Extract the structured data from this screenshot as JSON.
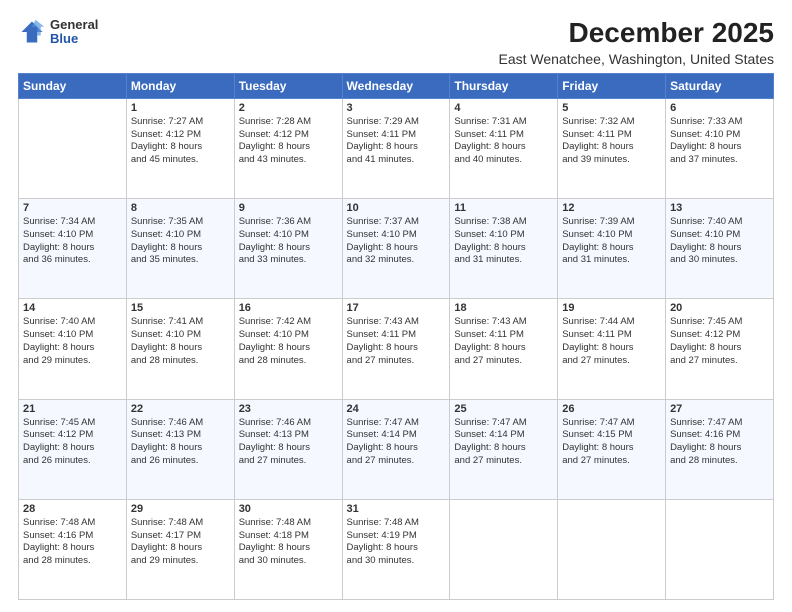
{
  "header": {
    "logo_general": "General",
    "logo_blue": "Blue",
    "title": "December 2025",
    "subtitle": "East Wenatchee, Washington, United States"
  },
  "weekdays": [
    "Sunday",
    "Monday",
    "Tuesday",
    "Wednesday",
    "Thursday",
    "Friday",
    "Saturday"
  ],
  "weeks": [
    [
      {
        "day": "",
        "info": ""
      },
      {
        "day": "1",
        "info": "Sunrise: 7:27 AM\nSunset: 4:12 PM\nDaylight: 8 hours\nand 45 minutes."
      },
      {
        "day": "2",
        "info": "Sunrise: 7:28 AM\nSunset: 4:12 PM\nDaylight: 8 hours\nand 43 minutes."
      },
      {
        "day": "3",
        "info": "Sunrise: 7:29 AM\nSunset: 4:11 PM\nDaylight: 8 hours\nand 41 minutes."
      },
      {
        "day": "4",
        "info": "Sunrise: 7:31 AM\nSunset: 4:11 PM\nDaylight: 8 hours\nand 40 minutes."
      },
      {
        "day": "5",
        "info": "Sunrise: 7:32 AM\nSunset: 4:11 PM\nDaylight: 8 hours\nand 39 minutes."
      },
      {
        "day": "6",
        "info": "Sunrise: 7:33 AM\nSunset: 4:10 PM\nDaylight: 8 hours\nand 37 minutes."
      }
    ],
    [
      {
        "day": "7",
        "info": "Sunrise: 7:34 AM\nSunset: 4:10 PM\nDaylight: 8 hours\nand 36 minutes."
      },
      {
        "day": "8",
        "info": "Sunrise: 7:35 AM\nSunset: 4:10 PM\nDaylight: 8 hours\nand 35 minutes."
      },
      {
        "day": "9",
        "info": "Sunrise: 7:36 AM\nSunset: 4:10 PM\nDaylight: 8 hours\nand 33 minutes."
      },
      {
        "day": "10",
        "info": "Sunrise: 7:37 AM\nSunset: 4:10 PM\nDaylight: 8 hours\nand 32 minutes."
      },
      {
        "day": "11",
        "info": "Sunrise: 7:38 AM\nSunset: 4:10 PM\nDaylight: 8 hours\nand 31 minutes."
      },
      {
        "day": "12",
        "info": "Sunrise: 7:39 AM\nSunset: 4:10 PM\nDaylight: 8 hours\nand 31 minutes."
      },
      {
        "day": "13",
        "info": "Sunrise: 7:40 AM\nSunset: 4:10 PM\nDaylight: 8 hours\nand 30 minutes."
      }
    ],
    [
      {
        "day": "14",
        "info": "Sunrise: 7:40 AM\nSunset: 4:10 PM\nDaylight: 8 hours\nand 29 minutes."
      },
      {
        "day": "15",
        "info": "Sunrise: 7:41 AM\nSunset: 4:10 PM\nDaylight: 8 hours\nand 28 minutes."
      },
      {
        "day": "16",
        "info": "Sunrise: 7:42 AM\nSunset: 4:10 PM\nDaylight: 8 hours\nand 28 minutes."
      },
      {
        "day": "17",
        "info": "Sunrise: 7:43 AM\nSunset: 4:11 PM\nDaylight: 8 hours\nand 27 minutes."
      },
      {
        "day": "18",
        "info": "Sunrise: 7:43 AM\nSunset: 4:11 PM\nDaylight: 8 hours\nand 27 minutes."
      },
      {
        "day": "19",
        "info": "Sunrise: 7:44 AM\nSunset: 4:11 PM\nDaylight: 8 hours\nand 27 minutes."
      },
      {
        "day": "20",
        "info": "Sunrise: 7:45 AM\nSunset: 4:12 PM\nDaylight: 8 hours\nand 27 minutes."
      }
    ],
    [
      {
        "day": "21",
        "info": "Sunrise: 7:45 AM\nSunset: 4:12 PM\nDaylight: 8 hours\nand 26 minutes."
      },
      {
        "day": "22",
        "info": "Sunrise: 7:46 AM\nSunset: 4:13 PM\nDaylight: 8 hours\nand 26 minutes."
      },
      {
        "day": "23",
        "info": "Sunrise: 7:46 AM\nSunset: 4:13 PM\nDaylight: 8 hours\nand 27 minutes."
      },
      {
        "day": "24",
        "info": "Sunrise: 7:47 AM\nSunset: 4:14 PM\nDaylight: 8 hours\nand 27 minutes."
      },
      {
        "day": "25",
        "info": "Sunrise: 7:47 AM\nSunset: 4:14 PM\nDaylight: 8 hours\nand 27 minutes."
      },
      {
        "day": "26",
        "info": "Sunrise: 7:47 AM\nSunset: 4:15 PM\nDaylight: 8 hours\nand 27 minutes."
      },
      {
        "day": "27",
        "info": "Sunrise: 7:47 AM\nSunset: 4:16 PM\nDaylight: 8 hours\nand 28 minutes."
      }
    ],
    [
      {
        "day": "28",
        "info": "Sunrise: 7:48 AM\nSunset: 4:16 PM\nDaylight: 8 hours\nand 28 minutes."
      },
      {
        "day": "29",
        "info": "Sunrise: 7:48 AM\nSunset: 4:17 PM\nDaylight: 8 hours\nand 29 minutes."
      },
      {
        "day": "30",
        "info": "Sunrise: 7:48 AM\nSunset: 4:18 PM\nDaylight: 8 hours\nand 30 minutes."
      },
      {
        "day": "31",
        "info": "Sunrise: 7:48 AM\nSunset: 4:19 PM\nDaylight: 8 hours\nand 30 minutes."
      },
      {
        "day": "",
        "info": ""
      },
      {
        "day": "",
        "info": ""
      },
      {
        "day": "",
        "info": ""
      }
    ]
  ]
}
